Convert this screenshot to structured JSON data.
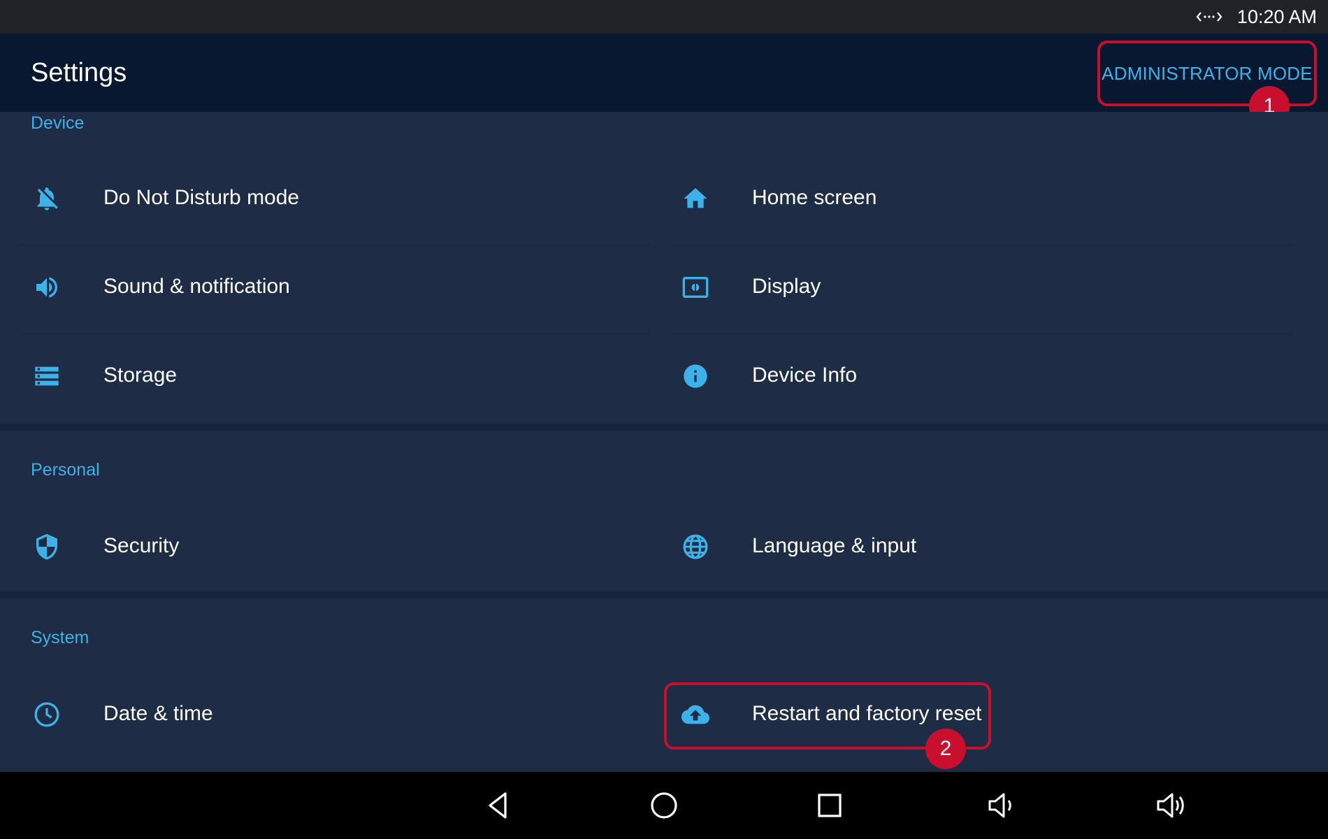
{
  "status_bar": {
    "time": "10:20 AM",
    "icon": "network-arrows-icon"
  },
  "app_bar": {
    "title": "Settings",
    "admin_button_label": "ADMINISTRATOR MODE"
  },
  "callouts": [
    "1",
    "2"
  ],
  "sections": {
    "device": {
      "header": "Device",
      "items": [
        {
          "label": "Do Not Disturb mode",
          "icon": "bell-off-icon"
        },
        {
          "label": "Home screen",
          "icon": "home-icon"
        },
        {
          "label": "Sound & notification",
          "icon": "speaker-icon"
        },
        {
          "label": "Display",
          "icon": "display-icon"
        },
        {
          "label": "Storage",
          "icon": "storage-icon"
        },
        {
          "label": "Device Info",
          "icon": "info-icon"
        }
      ]
    },
    "personal": {
      "header": "Personal",
      "items": [
        {
          "label": "Security",
          "icon": "shield-icon"
        },
        {
          "label": "Language & input",
          "icon": "globe-icon"
        }
      ]
    },
    "system": {
      "header": "System",
      "items": [
        {
          "label": "Date & time",
          "icon": "clock-icon"
        },
        {
          "label": "Restart and factory reset",
          "icon": "cloud-upload-icon"
        }
      ]
    }
  },
  "nav_bar": {
    "buttons": [
      "back-icon",
      "home-circle-icon",
      "recents-icon",
      "volume-down-icon",
      "volume-up-icon"
    ]
  },
  "colors": {
    "accent": "#3db2e8",
    "highlight": "#c8102e",
    "background": "#1d2b45",
    "app_bar": "#081830"
  }
}
